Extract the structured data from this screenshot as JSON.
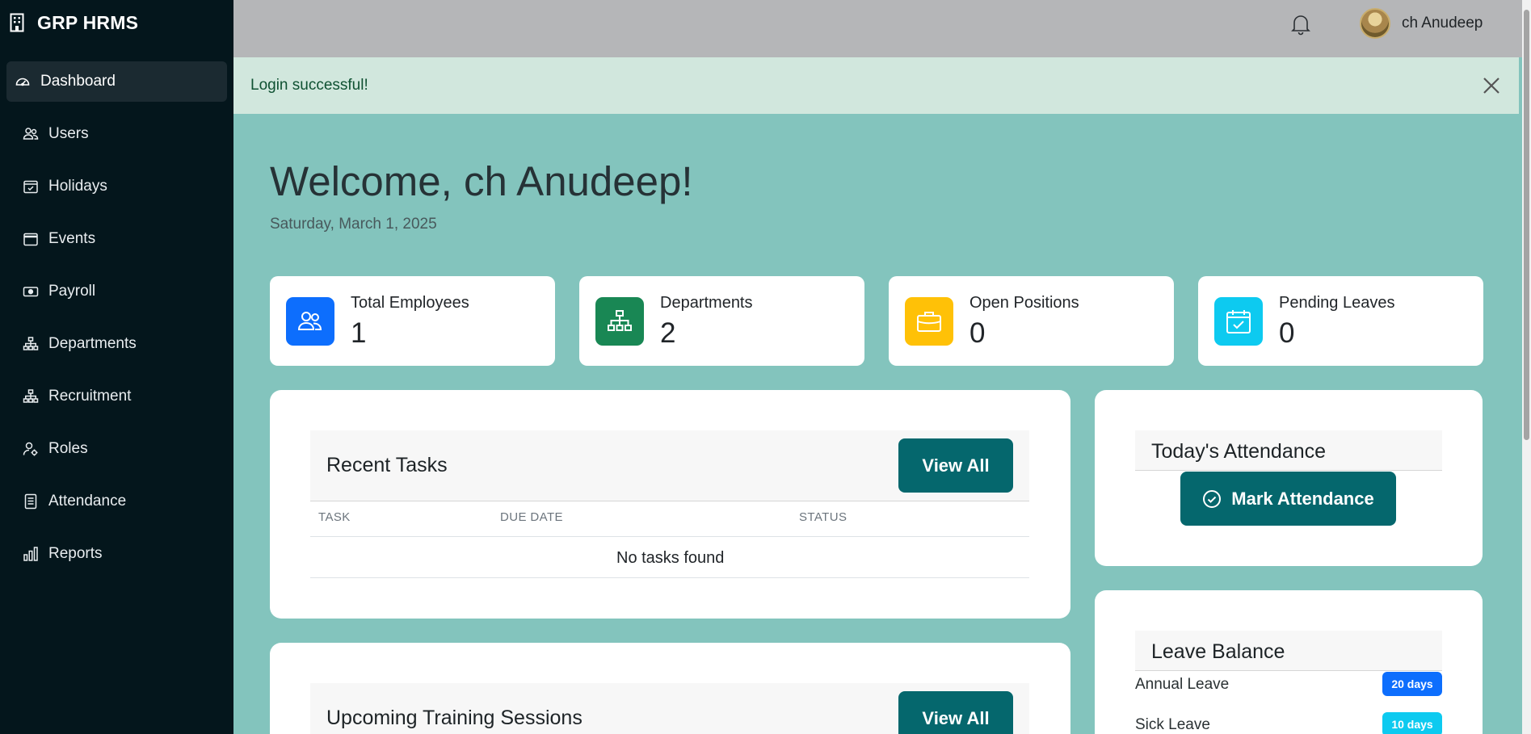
{
  "brand": {
    "name": "GRP HRMS"
  },
  "sidebar": {
    "items": [
      {
        "label": "Dashboard",
        "icon": "gauge-icon",
        "active": true
      },
      {
        "label": "Users",
        "icon": "people-icon"
      },
      {
        "label": "Holidays",
        "icon": "calendar-check-icon"
      },
      {
        "label": "Events",
        "icon": "calendar-icon"
      },
      {
        "label": "Payroll",
        "icon": "cash-icon"
      },
      {
        "label": "Departments",
        "icon": "org-chart-icon"
      },
      {
        "label": "Recruitment",
        "icon": "org-chart-icon"
      },
      {
        "label": "Roles",
        "icon": "person-gear-icon"
      },
      {
        "label": "Attendance",
        "icon": "document-icon"
      },
      {
        "label": "Reports",
        "icon": "bar-chart-icon"
      }
    ]
  },
  "topbar": {
    "user_name": "ch Anudeep"
  },
  "alert": {
    "message": "Login successful!"
  },
  "welcome": {
    "heading": "Welcome, ch Anudeep!",
    "date": "Saturday, March 1, 2025"
  },
  "stats": [
    {
      "label": "Total Employees",
      "value": "1",
      "color": "#0d6efd",
      "icon": "people-icon"
    },
    {
      "label": "Departments",
      "value": "2",
      "color": "#198754",
      "icon": "org-chart-icon"
    },
    {
      "label": "Open Positions",
      "value": "0",
      "color": "#ffc107",
      "icon": "briefcase-icon"
    },
    {
      "label": "Pending Leaves",
      "value": "0",
      "color": "#0dcaf0",
      "icon": "calendar-check-icon"
    }
  ],
  "recent_tasks": {
    "title": "Recent Tasks",
    "view_all": "View All",
    "columns": [
      "TASK",
      "DUE DATE",
      "STATUS"
    ],
    "empty": "No tasks found"
  },
  "training": {
    "title": "Upcoming Training Sessions",
    "view_all": "View All"
  },
  "attendance": {
    "title": "Today's Attendance",
    "button": "Mark Attendance"
  },
  "leave_balance": {
    "title": "Leave Balance",
    "items": [
      {
        "name": "Annual Leave",
        "badge": "20 days",
        "color": "#0d6efd"
      },
      {
        "name": "Sick Leave",
        "badge": "10 days",
        "color": "#0dcaf0"
      }
    ]
  },
  "colors": {
    "accent": "#05676d",
    "sidebar": "#04161c",
    "background": "#83c4bd",
    "alert": "#d1e7dd"
  }
}
